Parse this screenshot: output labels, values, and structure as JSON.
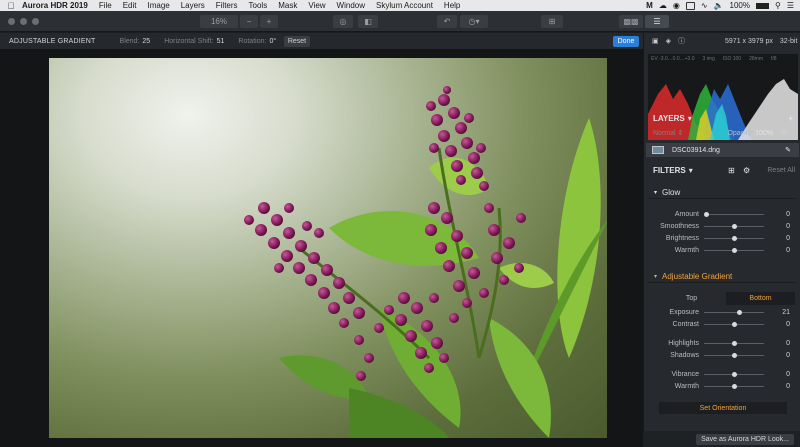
{
  "menubar": {
    "app_name": "Aurora HDR 2019",
    "items": [
      "File",
      "Edit",
      "Image",
      "Layers",
      "Filters",
      "Tools",
      "Mask",
      "View",
      "Window",
      "Skylum Account",
      "Help"
    ],
    "battery": "100%",
    "battery_pct": 100
  },
  "toolbar": {
    "zoom": "16%",
    "zoom_out": "−",
    "zoom_in": "+"
  },
  "options": {
    "title": "ADJUSTABLE GRADIENT",
    "blend_label": "Blend:",
    "blend_value": "25",
    "shift_label": "Horizontal Shift:",
    "shift_value": "51",
    "rotation_label": "Rotation:",
    "rotation_value": "0°",
    "reset_label": "Reset",
    "done_label": "Done"
  },
  "panel": {
    "dimensions": "5971 x 3979 px",
    "bit_depth": "32-bit",
    "exif": [
      "EV -3.0…0.0…+3.0",
      "3 img",
      "ISO 100",
      "28mm",
      "f/8"
    ],
    "layers_header": "LAYERS",
    "blend_mode": "Normal",
    "opacity_label": "Opacity:",
    "opacity_value": "100%",
    "layer_name": "DSC03914.dng",
    "filters_header": "FILTERS",
    "reset_all": "Reset All",
    "glow": {
      "title": "Glow",
      "sliders": [
        {
          "name": "Amount",
          "value": "0",
          "pos": 0.0
        },
        {
          "name": "Smoothness",
          "value": "0",
          "pos": 0.5
        },
        {
          "name": "Brightness",
          "value": "0",
          "pos": 0.5
        },
        {
          "name": "Warmth",
          "value": "0",
          "pos": 0.5
        }
      ]
    },
    "gradient": {
      "title": "Adjustable Gradient",
      "tab_top": "Top",
      "tab_bottom": "Bottom",
      "sliders": [
        {
          "name": "Exposure",
          "value": "21",
          "pos": 0.6
        },
        {
          "name": "Contrast",
          "value": "0",
          "pos": 0.5
        },
        {
          "name": "Highlights",
          "value": "0",
          "pos": 0.5
        },
        {
          "name": "Shadows",
          "value": "0",
          "pos": 0.5
        },
        {
          "name": "Vibrance",
          "value": "0",
          "pos": 0.5
        },
        {
          "name": "Warmth",
          "value": "0",
          "pos": 0.5
        }
      ],
      "set_orientation": "Set Orientation"
    },
    "save_look": "Save as Aurora HDR Look..."
  },
  "colors": {
    "accent": "#f2a33a",
    "done_blue": "#2b7fd6",
    "flower_purple": "#8a1e5e",
    "leaf_green": "#7cb83a"
  }
}
